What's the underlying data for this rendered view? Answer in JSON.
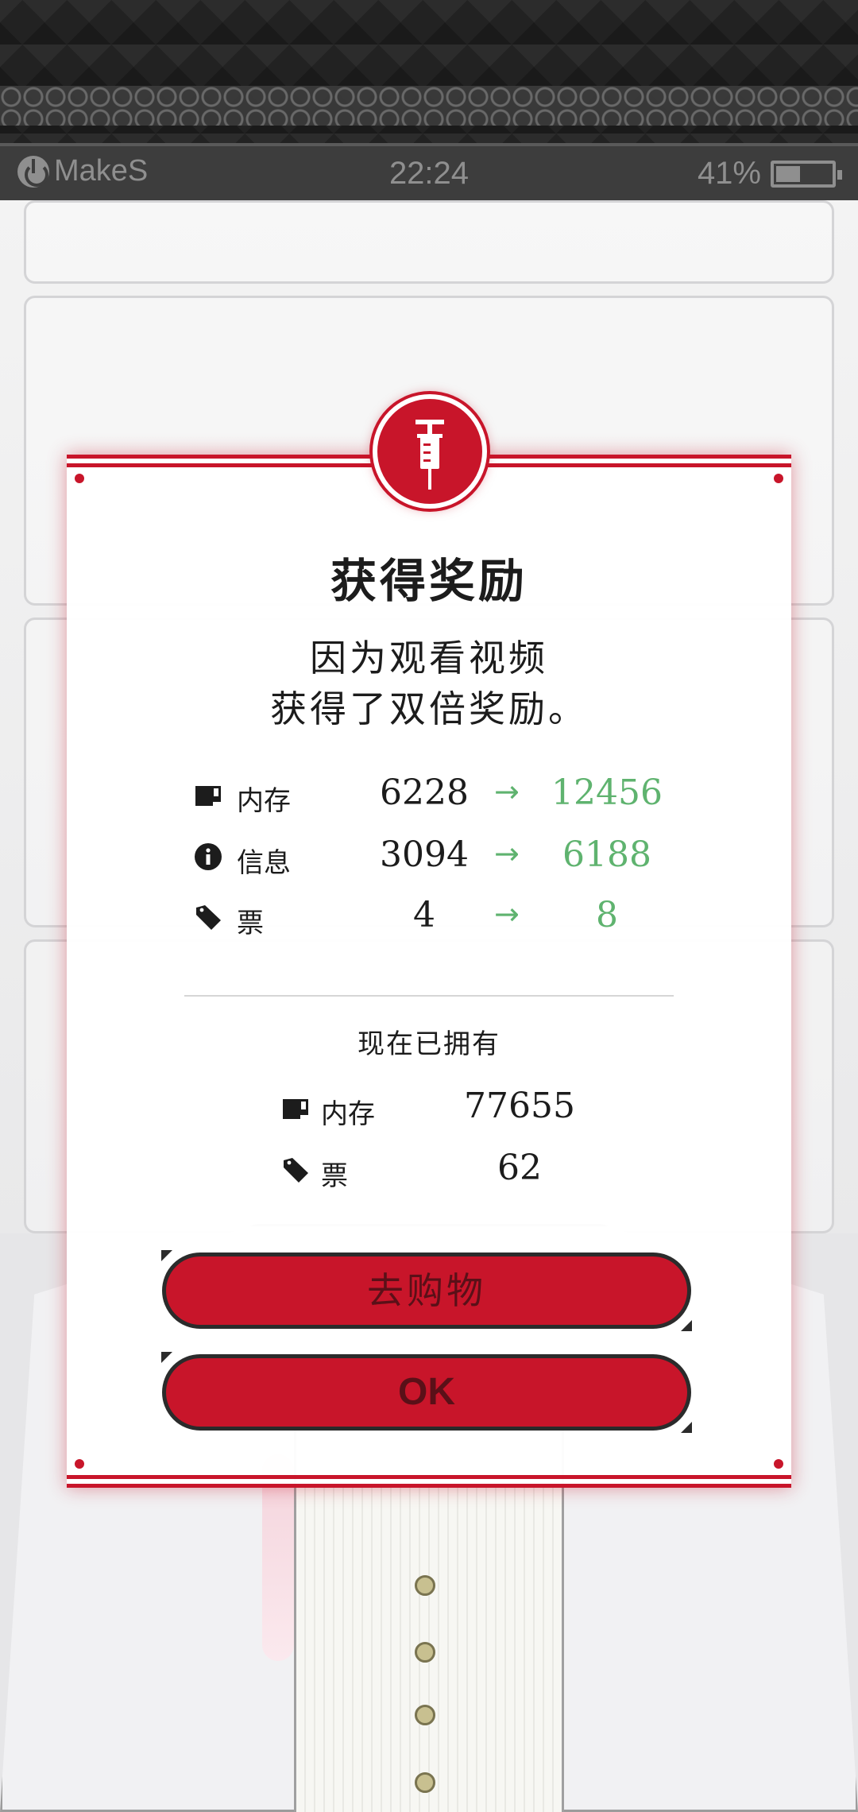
{
  "status_bar": {
    "brand": "MakeS",
    "time": "22:24",
    "battery": "41%",
    "battery_level": 0.41
  },
  "dialog": {
    "emblem_icon": "syringe-icon",
    "title": "获得奖励",
    "description_line1": "因为观看视频",
    "description_line2": "获得了双倍奖励。",
    "rewards": [
      {
        "icon": "memory-card-icon",
        "label": "内存",
        "old": "6228",
        "arrow": "→",
        "new": "12456"
      },
      {
        "icon": "info-icon",
        "label": "信息",
        "old": "3094",
        "arrow": "→",
        "new": "6188"
      },
      {
        "icon": "ticket-icon",
        "label": "票",
        "old": "4",
        "arrow": "→",
        "new": "8"
      }
    ],
    "owned_title": "现在已拥有",
    "owned": [
      {
        "icon": "memory-card-icon",
        "label": "内存",
        "value": "77655"
      },
      {
        "icon": "ticket-icon",
        "label": "票",
        "value": "62"
      }
    ],
    "shop_button": "去购物",
    "ok_button": "OK"
  },
  "colors": {
    "accent": "#c8152a",
    "increase": "#5fb36f",
    "text": "#1c1c1c"
  }
}
